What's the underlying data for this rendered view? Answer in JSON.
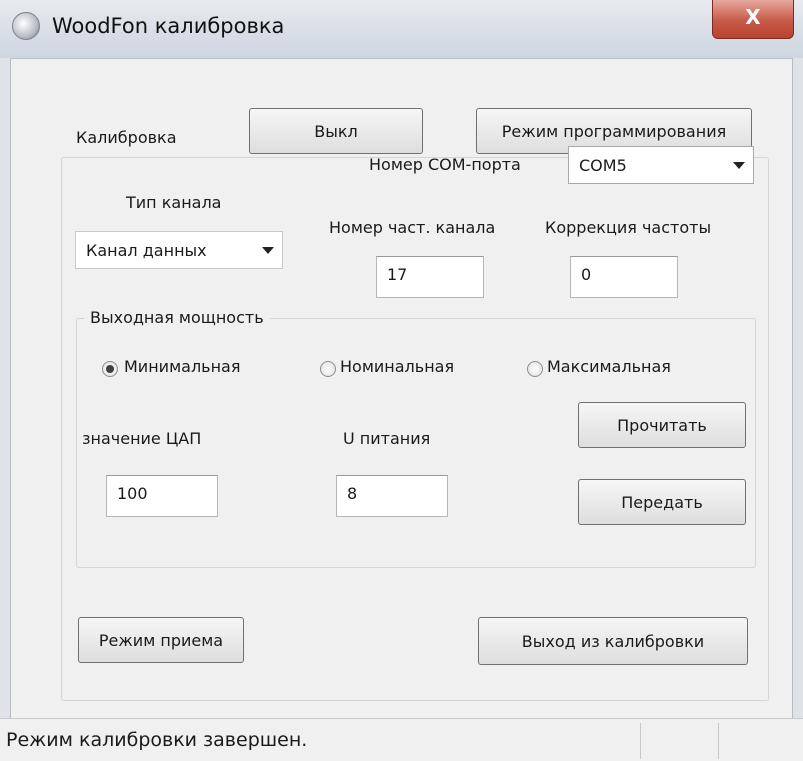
{
  "window": {
    "title": "WoodFon калибровка",
    "close_glyph": "X"
  },
  "top_buttons": {
    "off_label": "Выкл",
    "program_mode_label": "Режим программирования"
  },
  "calibration": {
    "group_title": "Калибровка",
    "com_port": {
      "label": "Номер COM-порта",
      "selected": "COM5"
    },
    "channel_type": {
      "label": "Тип канала",
      "selected": "Канал данных"
    },
    "freq_channel": {
      "label": "Номер част. канала",
      "value": "17"
    },
    "freq_correction": {
      "label": "Коррекция частоты",
      "value": "0"
    }
  },
  "output_power": {
    "group_title": "Выходная мощность",
    "options": [
      "Минимальная",
      "Номинальная",
      "Максимальная"
    ],
    "selected": "Минимальная",
    "dac": {
      "label": "значение ЦАП",
      "value": "100"
    },
    "supply": {
      "label": "U питания",
      "value": "8"
    },
    "read_label": "Прочитать",
    "send_label": "Передать"
  },
  "bottom_buttons": {
    "receive_mode_label": "Режим приема",
    "exit_calibration_label": "Выход из калибровки"
  },
  "status": {
    "text": "Режим калибровки завершен."
  }
}
